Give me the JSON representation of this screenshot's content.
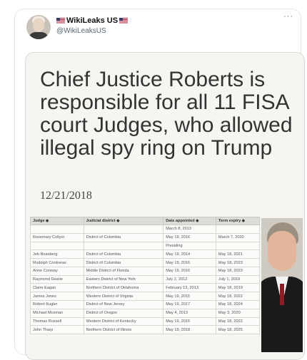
{
  "tweet": {
    "display_name": "WikiLeaks US",
    "handle": "@WikiLeaksUS",
    "more_icon": "···"
  },
  "image": {
    "headline": "Chief Justice Roberts is responsible for all 11 FISA court Judges, who allowed illegal spy ring on Trump",
    "date": "12/21/2018",
    "table": {
      "headers": [
        "Judge ◆",
        "Judicial district ◆",
        "Date appointed ◆",
        "Term expiry ◆"
      ],
      "rows": [
        [
          "",
          "",
          "March 8, 2013",
          ""
        ],
        [
          "Rosemary Collyer",
          "District of Columbia",
          "May 19, 2016",
          "March 7, 2020"
        ],
        [
          "",
          "",
          "Presiding",
          ""
        ],
        [
          "Jeb Boasberg",
          "District of Columbia",
          "May 19, 2014",
          "May 18, 2021"
        ],
        [
          "Rudolph Contreras",
          "District of Columbia",
          "May 19, 2016",
          "May 18, 2023"
        ],
        [
          "Anne Conway",
          "Middle District of Florida",
          "May 19, 2016",
          "May 18, 2023"
        ],
        [
          "Raymond Dearie",
          "Eastern District of New York",
          "July 2, 2012",
          "July 1, 2019"
        ],
        [
          "Claire Eagan",
          "Northern District of Oklahoma",
          "February 13, 2013",
          "May 18, 2019"
        ],
        [
          "James Jones",
          "Western District of Virginia",
          "May 19, 2015",
          "May 18, 2022"
        ],
        [
          "Robert Kugler",
          "District of New Jersey",
          "May 19, 2017",
          "May 18, 2024"
        ],
        [
          "Michael Mosman",
          "District of Oregon",
          "May 4, 2013",
          "May 3, 2020"
        ],
        [
          "Thomas Russell",
          "Western District of Kentucky",
          "May 19, 2015",
          "May 18, 2022"
        ],
        [
          "John Tharp",
          "Northern District of Illinois",
          "May 19, 2018",
          "May 18, 2025"
        ]
      ]
    }
  },
  "icons": {
    "flag": "us-flag-icon",
    "more": "ellipsis-icon"
  }
}
